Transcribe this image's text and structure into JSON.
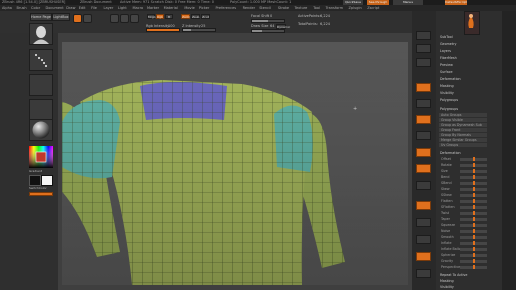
{
  "app": {
    "title": "ZBrush 4R6 [1.54.0] [ZBRUSHUSER]",
    "document": "ZBrush Document",
    "memory": "Active Mem: 971 Scratch Disk: 0 Free Mem: 0 Time: 0",
    "poly_info": "PolyCount: 1.000 MP MeshCount: 1",
    "buttons": [
      "QuickSave",
      "See-through",
      "Menus",
      "DefaultZScript"
    ]
  },
  "menus": [
    "Alpha",
    "Brush",
    "Color",
    "Document",
    "Draw",
    "Edit",
    "File",
    "Layer",
    "Light",
    "Macro",
    "Marker",
    "Material",
    "Movie",
    "Picker",
    "Preferences",
    "Render",
    "Stencil",
    "Stroke",
    "Texture",
    "Tool",
    "Transform",
    "Zplugin",
    "Zscript"
  ],
  "toolbar": {
    "home_label": "Home Page",
    "lightbox_label": "LightBox",
    "edit_label": "Edit",
    "draw_label": "Draw",
    "move_label": "Move",
    "scale_label": "Scale",
    "rotate_label": "Rotate",
    "mrgb": "Mrgb",
    "rgb": "Rgb",
    "m": "M",
    "zadd": "Zadd",
    "zsub": "Zsub",
    "zcut": "Zcut",
    "focal_shift_label": "Focal Shift",
    "focal_shift_value": "0",
    "draw_size_label": "Draw Size",
    "draw_size_value": "64",
    "dynamic_label": "Dynamic",
    "rgb_intensity_label": "Rgb Intensity",
    "rgb_intensity_value": "100",
    "z_intensity_label": "Z Intensity",
    "z_intensity_value": "25",
    "active_points_label": "ActivePoints:",
    "active_points_value": "6,224",
    "total_points_label": "TotalPoints:",
    "total_points_value": "6,224"
  },
  "left_shelf": {
    "gradient_label": "Gradient",
    "switch_color_label": "SwitchColor",
    "alternate_label": "Alternate"
  },
  "palette": {
    "header": [
      "SubTool",
      "Geometry",
      "Layers",
      "FiberMesh",
      "Preview",
      "Surface",
      "Deformation",
      "Masking",
      "Visibility",
      "Polygroups"
    ],
    "polygroups": {
      "title": "Polygroups",
      "items": [
        {
          "label": "Auto Groups",
          "slider": false
        },
        {
          "label": "Group Visible",
          "slider": false
        },
        {
          "label": "Group as Dynamesh Sub",
          "slider": false
        },
        {
          "label": "Group Front",
          "slider": false
        },
        {
          "label": "Group By Normals",
          "slider": true,
          "value": 0.6
        },
        {
          "label": "Merge Similar Groups",
          "slider": true,
          "value": 0.5
        },
        {
          "label": "Uv Groups",
          "slider": false
        }
      ]
    },
    "deformation": {
      "title": "Deformation",
      "items": [
        {
          "label": "Offset",
          "value": 0.5
        },
        {
          "label": "Rotate",
          "value": 0.5
        },
        {
          "label": "Size",
          "value": 0.5
        },
        {
          "label": "Bend",
          "value": 0.5
        },
        {
          "label": "SBend",
          "value": 0.5
        },
        {
          "label": "Skew",
          "value": 0.5
        },
        {
          "label": "SSkew",
          "value": 0.5
        },
        {
          "label": "Flatten",
          "value": 0.5
        },
        {
          "label": "SFlatten",
          "value": 0.5
        },
        {
          "label": "Twist",
          "value": 0.5
        },
        {
          "label": "Taper",
          "value": 0.5
        },
        {
          "label": "Squeeze",
          "value": 0.5
        },
        {
          "label": "Noise",
          "value": 0.5
        },
        {
          "label": "Smooth",
          "value": 0.5
        },
        {
          "label": "Inflate",
          "value": 0.5
        },
        {
          "label": "Inflate Balloon",
          "value": 0.5
        },
        {
          "label": "Spherize",
          "value": 0.5
        },
        {
          "label": "Gravity",
          "value": 0.5
        },
        {
          "label": "Perspective",
          "value": 0.5
        }
      ]
    },
    "footer": [
      "Repeat To Active",
      "Masking",
      "Visibility",
      "Polygroups"
    ]
  },
  "colors": {
    "accent": "#e0701d",
    "mesh_base": "#a8ba5e",
    "mesh_shoulder": "#62b7aa",
    "mesh_neck": "#6e6bc4"
  }
}
